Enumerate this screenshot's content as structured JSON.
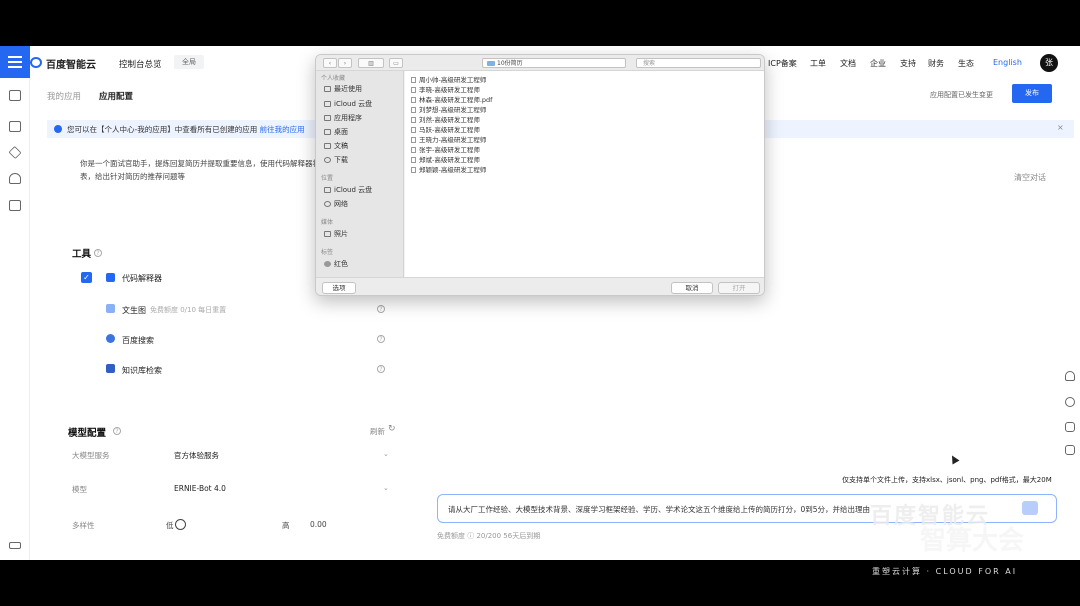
{
  "colors": {
    "accent": "#2468f2",
    "notice_bg": "#eef4ff"
  },
  "header": {
    "logo": "百度智能云",
    "console": "控制台总览",
    "region": "全局",
    "nav": [
      "ICP备案",
      "工单",
      "文档",
      "企业",
      "支持",
      "财务",
      "生态",
      "English"
    ],
    "avatar": "张"
  },
  "breadcrumb": {
    "parent": "我的应用",
    "current": "应用配置"
  },
  "status_text": "应用配置已发生变更",
  "publish_label": "发布",
  "notice": {
    "text": "您可以在【个人中心-我的应用】中查看所有已创建的应用",
    "link": "前往我的应用"
  },
  "description": {
    "line1": "你是一个面试官助手，提炼回复简历并提取重要信息，使用代码解释器将",
    "line2": "表，给出针对简历的推荐问题等"
  },
  "clear_label": "清空对话",
  "tools": {
    "title": "工具",
    "items": [
      {
        "label": "代码解释器",
        "checked": true
      },
      {
        "label": "文生图",
        "extra": "免费额度  0/10 每日重置"
      },
      {
        "label": "百度搜索"
      },
      {
        "label": "知识库检索"
      }
    ]
  },
  "model": {
    "title": "模型配置",
    "reset": "刷新",
    "service_label": "大模型服务",
    "service_value": "官方体验服务",
    "model_label": "模型",
    "model_value": "ERNIE-Bot 4.0",
    "diversity_label": "多样性",
    "low": "低",
    "high": "高",
    "diversity_value": "0.00"
  },
  "upload_tip": "仅支持单个文件上传，支持xlsx、jsonl、png、pdf格式，最大20M",
  "prompt": {
    "text": "请从大厂工作经验、大模型技术背景、深度学习框架经验、学历、学术论文这五个维度给上传的简历打分，0到5分，并给出理由",
    "meta": "免费额度  ⓘ 20/200  56天后到期"
  },
  "dialog": {
    "folder": "10份简历",
    "search_placeholder": "搜索",
    "sections": [
      {
        "title": "个人收藏",
        "items": [
          "最近使用",
          "iCloud 云盘",
          "应用程序",
          "桌面",
          "文稿",
          "下载"
        ]
      },
      {
        "title": "位置",
        "items": [
          "iCloud 云盘",
          "网络"
        ]
      },
      {
        "title": "媒体",
        "items": [
          "照片"
        ]
      },
      {
        "title": "标签",
        "items": [
          "红色"
        ]
      }
    ],
    "files": [
      "周小帅-高级研发工程师",
      "李晓-高级研发工程师",
      "林森-高级研发工程师.pdf",
      "刘梦想-高级研发工程师",
      "刘然-高级研发工程师",
      "马跃-高级研发工程师",
      "王晓力-高级研发工程师",
      "张宇-高级研发工程师",
      "郑斌-高级研发工程师",
      "郑颖颖-高级研发工程师"
    ],
    "options_label": "选项",
    "cancel_label": "取消",
    "open_label": "打开"
  },
  "watermark": {
    "line1": "百度智能云",
    "line2": "智算大会",
    "line3": "重塑云计算 · CLOUD FOR AI"
  }
}
